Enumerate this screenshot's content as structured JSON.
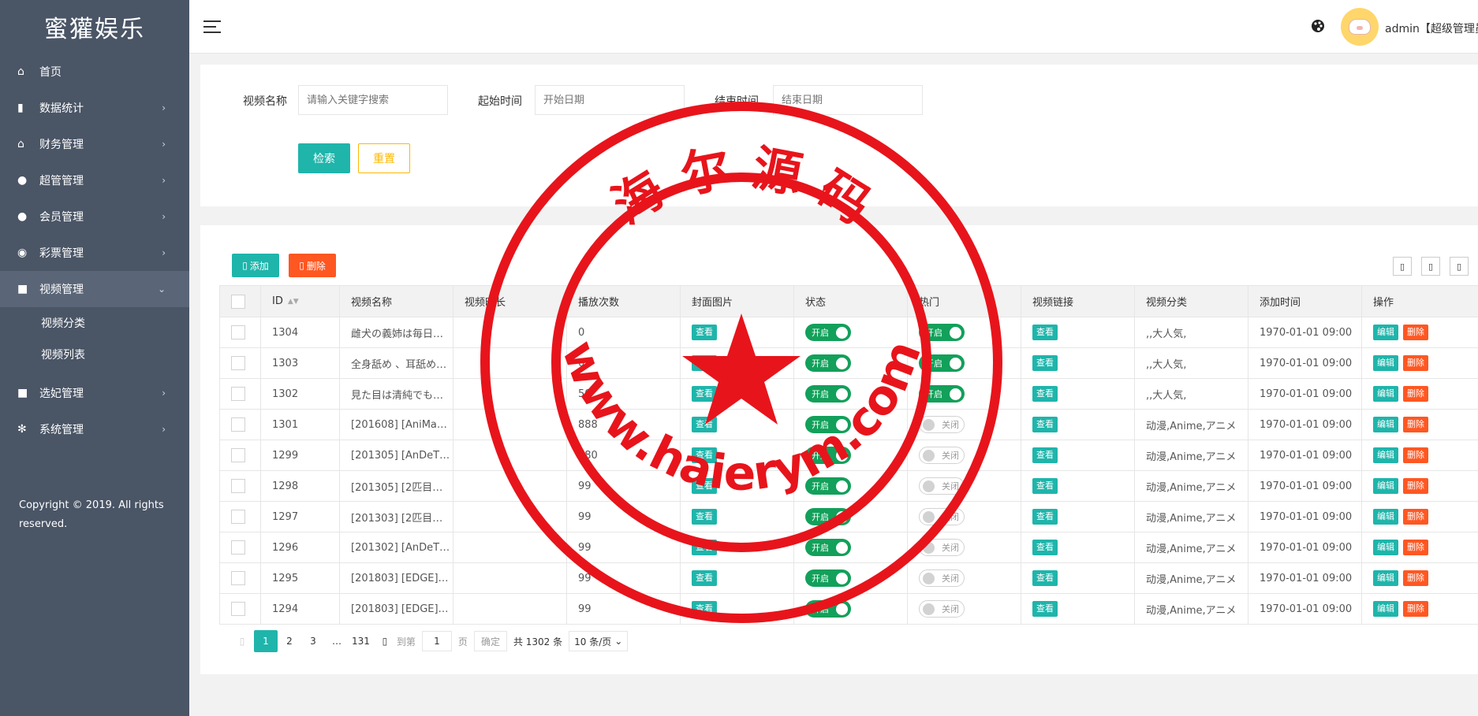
{
  "app": {
    "title": "蜜獾娱乐"
  },
  "sidebar": {
    "items": [
      {
        "label": "首页",
        "icon": "home-icon",
        "glyph": "⌂",
        "has_arrow": false
      },
      {
        "label": "数据统计",
        "icon": "bar-chart-icon",
        "glyph": "▮",
        "has_arrow": true
      },
      {
        "label": "财务管理",
        "icon": "bank-icon",
        "glyph": "⌂",
        "has_arrow": true
      },
      {
        "label": "超管管理",
        "icon": "user-icon",
        "glyph": "●",
        "has_arrow": true
      },
      {
        "label": "会员管理",
        "icon": "users-icon",
        "glyph": "●",
        "has_arrow": true
      },
      {
        "label": "彩票管理",
        "icon": "gamepad-icon",
        "glyph": "◉",
        "has_arrow": true
      },
      {
        "label": "视频管理",
        "icon": "video-icon",
        "glyph": "■",
        "has_arrow": true,
        "expanded": true
      },
      {
        "label": "选妃管理",
        "icon": "video-icon",
        "glyph": "■",
        "has_arrow": true
      },
      {
        "label": "系统管理",
        "icon": "gear-icon",
        "glyph": "✻",
        "has_arrow": true
      }
    ],
    "sub_items": [
      "视频分类",
      "视频列表"
    ],
    "copyright": "Copyright © 2019. All rights reserved."
  },
  "header": {
    "username": "admin【超级管理员】"
  },
  "search": {
    "name_label": "视频名称",
    "name_placeholder": "请输入关键字搜索",
    "start_label": "起始时间",
    "start_placeholder": "开始日期",
    "end_label": "结束时间",
    "end_placeholder": "结束日期",
    "search_button": "检索",
    "reset_button": "重置"
  },
  "toolbar": {
    "add_label": "添加",
    "delete_label": "删除"
  },
  "table": {
    "columns": [
      "ID",
      "视频名称",
      "视频时长",
      "播放次数",
      "封面图片",
      "状态",
      "热门",
      "视频链接",
      "视频分类",
      "添加时间",
      "操作"
    ],
    "view_label": "查看",
    "edit_label": "编辑",
    "delete_label": "删除",
    "on_label": "开启",
    "off_label": "关闭",
    "rows": [
      {
        "id": "1304",
        "name": "雌犬の義姉は毎日の…",
        "duration": "",
        "plays": "0",
        "status": "on",
        "hot": "on",
        "category": ",,大人気,",
        "time": "1970-01-01 09:00"
      },
      {
        "id": "1303",
        "name": "全身舐め 、耳舐め…",
        "duration": "",
        "plays": "0",
        "status": "on",
        "hot": "on",
        "category": ",,大人気,",
        "time": "1970-01-01 09:00"
      },
      {
        "id": "1302",
        "name": "見た目は清純でも…",
        "duration": "",
        "plays": "50",
        "status": "on",
        "hot": "on",
        "category": ",,大人気,",
        "time": "1970-01-01 09:00"
      },
      {
        "id": "1301",
        "name": "[201608] [AniMan]…",
        "duration": "",
        "plays": "888",
        "status": "on",
        "hot": "off",
        "category": "动漫,Anime,アニメ",
        "time": "1970-01-01 09:00"
      },
      {
        "id": "1299",
        "name": "[201305] [AnDeTv]…",
        "duration": "",
        "plays": "880",
        "status": "on",
        "hot": "off",
        "category": "动漫,Anime,アニメ",
        "time": "1970-01-01 09:00"
      },
      {
        "id": "1298",
        "name": "[201305] [2匹目の…",
        "duration": "",
        "plays": "99",
        "status": "on",
        "hot": "off",
        "category": "动漫,Anime,アニメ",
        "time": "1970-01-01 09:00"
      },
      {
        "id": "1297",
        "name": "[201303] [2匹目の…",
        "duration": "",
        "plays": "99",
        "status": "on",
        "hot": "off",
        "category": "动漫,Anime,アニメ",
        "time": "1970-01-01 09:00"
      },
      {
        "id": "1296",
        "name": "[201302] [AnDeTv]…",
        "duration": "",
        "plays": "99",
        "status": "on",
        "hot": "off",
        "category": "动漫,Anime,アニメ",
        "time": "1970-01-01 09:00"
      },
      {
        "id": "1295",
        "name": "[201803] [EDGE]…",
        "duration": "",
        "plays": "99",
        "status": "on",
        "hot": "off",
        "category": "动漫,Anime,アニメ",
        "time": "1970-01-01 09:00"
      },
      {
        "id": "1294",
        "name": "[201803] [EDGE]…",
        "duration": "",
        "plays": "99",
        "status": "on",
        "hot": "off",
        "category": "动漫,Anime,アニメ",
        "time": "1970-01-01 09:00"
      }
    ]
  },
  "pagination": {
    "pages": [
      "1",
      "2",
      "3",
      "…",
      "131"
    ],
    "current": "1",
    "goto_label": "到第",
    "goto_value": "1",
    "page_unit": "页",
    "confirm_label": "确定",
    "total_label": "共 1302 条",
    "page_size": "10 条/页"
  },
  "watermark": {
    "top_text": "海 尔 源 码",
    "bottom_text": "www.haierym.com",
    "color": "#e8141b"
  },
  "colors": {
    "sidebar_bg": "#4a5566",
    "primary": "#1fb5ab",
    "danger": "#ff5722",
    "warm": "#ffb800",
    "switch_on": "#12a05a"
  }
}
